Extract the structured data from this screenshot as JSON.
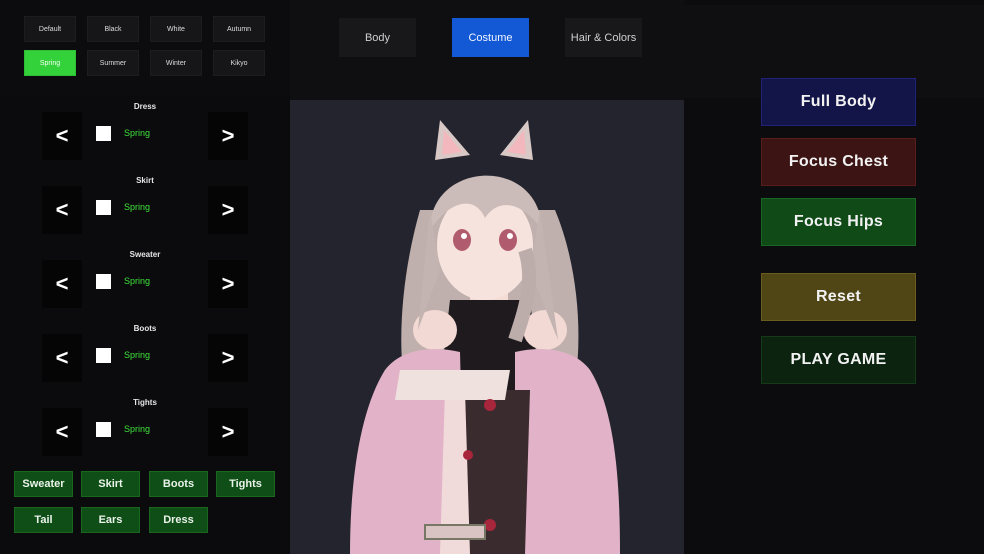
{
  "presets": [
    "Default",
    "Black",
    "White",
    "Autumn",
    "Spring",
    "Summer",
    "Winter",
    "Kikyo"
  ],
  "active_preset": "Spring",
  "tabs": [
    {
      "label": "Body"
    },
    {
      "label": "Costume"
    },
    {
      "label": "Hair & Colors"
    }
  ],
  "active_tab": "Costume",
  "slots": [
    {
      "title": "Dress",
      "value": "Spring",
      "prev": "<",
      "next": ">"
    },
    {
      "title": "Skirt",
      "value": "Spring",
      "prev": "<",
      "next": ">"
    },
    {
      "title": "Sweater",
      "value": "Spring",
      "prev": "<",
      "next": ">"
    },
    {
      "title": "Boots",
      "value": "Spring",
      "prev": "<",
      "next": ">"
    },
    {
      "title": "Tights",
      "value": "Spring",
      "prev": "<",
      "next": ">"
    }
  ],
  "toggles": [
    "Sweater",
    "Skirt",
    "Boots",
    "Tights",
    "Tail",
    "Ears",
    "Dress"
  ],
  "camera_buttons": {
    "full_body": "Full Body",
    "focus_chest": "Focus Chest",
    "focus_hips": "Focus Hips",
    "reset": "Reset",
    "play": "PLAY GAME"
  },
  "colors": {
    "accent_green": "#33d13a",
    "tab_active": "#1358d4",
    "value_green": "#3ee33a",
    "full_body_bg": "#131448",
    "focus_chest_bg": "#3d1414",
    "focus_hips_bg": "#0f4a17",
    "reset_bg": "#504514",
    "play_bg": "#0c2310"
  }
}
